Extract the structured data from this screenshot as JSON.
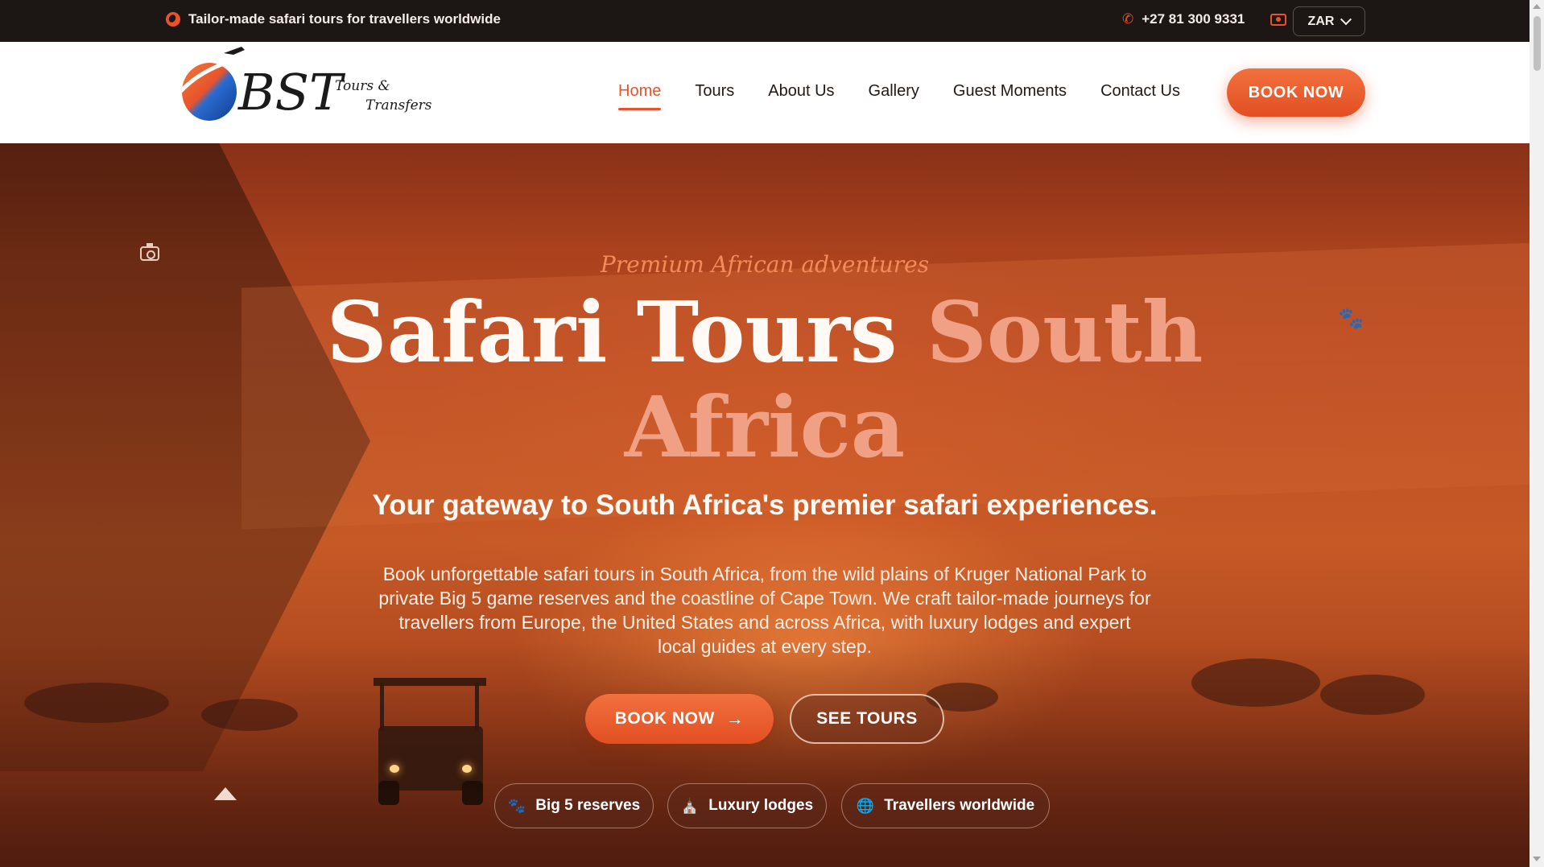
{
  "topbar": {
    "tagline": "Tailor-made safari tours for travellers worldwide",
    "tagline_icon": "globe-icon",
    "phone": "+27 81 300 9331",
    "phone_icon": "phone-icon",
    "currency_icon": "money-icon",
    "currency": "ZAR"
  },
  "logo": {
    "mark": "BST",
    "tours": "Tours &",
    "transfers": "Transfers"
  },
  "nav": {
    "items": [
      {
        "label": "Home",
        "active": true
      },
      {
        "label": "Tours",
        "active": false
      },
      {
        "label": "About Us",
        "active": false
      },
      {
        "label": "Gallery",
        "active": false
      },
      {
        "label": "Guest Moments",
        "active": false
      },
      {
        "label": "Contact Us",
        "active": false
      }
    ],
    "book_now": "BOOK NOW"
  },
  "hero": {
    "eyebrow": "Premium African adventures",
    "headline_white": "Safari Tours",
    "headline_accent_1": "South",
    "headline_accent_2": "Africa",
    "subhead": "Your gateway to South Africa's premier safari experiences.",
    "lead": "Book unforgettable safari tours in South Africa, from the wild plains of Kruger National Park to private Big 5 game reserves and the coastline of Cape Town. We craft tailor-made journeys for travellers from Europe, the United States and across Africa, with luxury lodges and expert local guides at every step.",
    "book_button": "BOOK NOW",
    "tours_button": "SEE TOURS",
    "chips": [
      {
        "label": "Big 5 reserves",
        "icon": "paw-icon"
      },
      {
        "label": "Luxury lodges",
        "icon": "lodge-icon"
      },
      {
        "label": "Travellers worldwide",
        "icon": "globe-icon"
      }
    ]
  },
  "colors": {
    "accent": "#e8532c",
    "topbar_bg": "#1c1714",
    "nav_bg": "#ffffff",
    "headline_accent": "#f0a084"
  }
}
